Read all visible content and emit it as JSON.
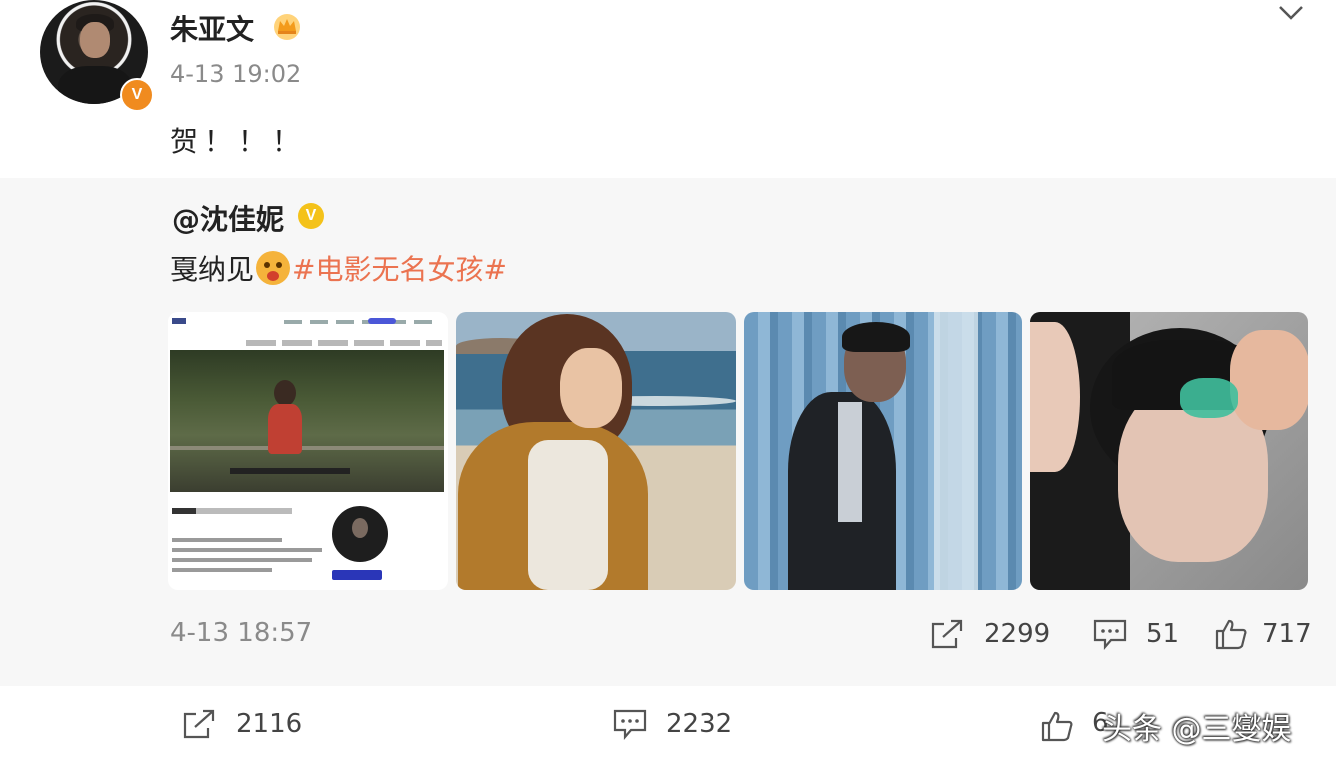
{
  "post": {
    "author": "朱亚文",
    "verified_badge": "V",
    "time": "4-13 19:02",
    "text": "贺！！！"
  },
  "repost": {
    "author": "@沈佳妮",
    "verified_badge": "V",
    "text_prefix": "戛纳见",
    "hashtag": "#电影无名女孩#",
    "time": "4-13 18:57",
    "repost_count": "2299",
    "comment_count": "51",
    "like_count": "717",
    "images": [
      "webpage-screenshot",
      "woman-on-beach",
      "man-by-curtains",
      "face-close-up"
    ]
  },
  "footer": {
    "repost_count": "2116",
    "comment_count": "2232",
    "like_count_partial": "6",
    "watermark": "头条 @三燮娱"
  },
  "colors": {
    "hashtag": "#eb7350",
    "verified_orange": "#f08b1f",
    "verified_yellow": "#f4c21a",
    "repost_background": "#f7f7f7"
  },
  "icons": [
    "crown-icon",
    "chevron-down-icon",
    "repost-icon",
    "comment-icon",
    "like-icon",
    "emoji-icon"
  ]
}
